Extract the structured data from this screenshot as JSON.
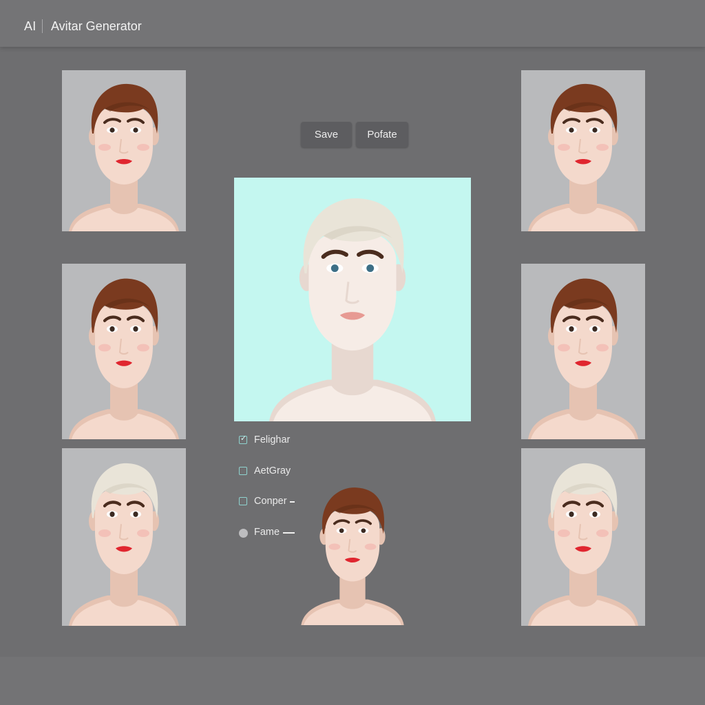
{
  "header": {
    "brand": "AI",
    "title": "Avitar Generator"
  },
  "toolbar": {
    "save_label": "Save",
    "second_label": "Pofate"
  },
  "colors": {
    "background": "#6e6e70",
    "preview_background": "#c4f7f0",
    "thumb_background": "#b9babc",
    "hair_brown": "#7a3a1f",
    "hair_platinum": "#e9e4d8",
    "lips_red": "#e0262f"
  },
  "options": [
    {
      "label": "Felighar",
      "control": "checkbox",
      "checked": true
    },
    {
      "label": "AetGray",
      "control": "checkbox",
      "checked": false
    },
    {
      "label": "Conper",
      "control": "checkbox",
      "checked": false
    },
    {
      "label": "Fame",
      "control": "radio",
      "checked": false
    }
  ],
  "avatars": [
    {
      "name": "avatar-variant-1",
      "hair": "brown"
    },
    {
      "name": "avatar-variant-2",
      "hair": "brown"
    },
    {
      "name": "avatar-variant-3",
      "hair": "platinum"
    },
    {
      "name": "avatar-variant-4",
      "hair": "brown"
    },
    {
      "name": "avatar-variant-5",
      "hair": "brown"
    },
    {
      "name": "avatar-variant-6",
      "hair": "platinum"
    }
  ],
  "preview": {
    "hair": "platinum"
  },
  "floating_avatar": {
    "hair": "brown"
  }
}
